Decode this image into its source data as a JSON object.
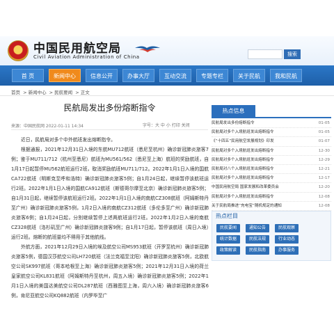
{
  "header": {
    "cn_title": "中国民用航空局",
    "en_title": "Civil Aviation Administration of China",
    "search_placeholder": "",
    "search_button": "搜索"
  },
  "nav": {
    "items": [
      {
        "label": "首 页",
        "active": false
      },
      {
        "label": "新闻中心",
        "active": true
      },
      {
        "label": "信息公开",
        "active": false
      },
      {
        "label": "办事大厅",
        "active": false
      },
      {
        "label": "互动交流",
        "active": false
      },
      {
        "label": "专题专栏",
        "active": false
      },
      {
        "label": "关于民航",
        "active": false
      },
      {
        "label": "我和民航",
        "active": false
      }
    ]
  },
  "breadcrumb": [
    "首页",
    "> 新闻中心",
    "> 民航要闻",
    "> 正文"
  ],
  "article": {
    "title": "民航局发出多份熔断指令",
    "meta_left": "来源：中国民航网     2022-01-11 14:34",
    "meta_right": "字号：大 中 小    打印    关闭",
    "paragraphs": [
      "近日，民航局对多个中外航班发出熔断指令。",
      "根据通报，2021年12月31日入境的东航MU712航班（悉尼至杭州）确诊新冠肺炎旅客7例；鉴于MU711/712（杭州至悉尼）航班为MU561/562（悉尼至上海）航班的奖励航班，自1月17日起暂停MU562航班运行2班，取消奖励航班MU711/712。2022年1月1日入境的国航CA722航班（明斯克至呼和浩特）确诊新冠肺炎旅客5例；自1月24日起，继续暂停该航班运行2班。2022年1月1日入境的国航CA912航班（斯德哥尔摩至北京）确诊新冠肺炎旅客5例；自1月31日起，继续暂停该航班运行2班。2022年1月1日入境的南航CZ308航班（阿姆斯特丹至广州）确诊新冠肺炎旅客5例，1月2日入境的南航CZ312航班（多伦多至广州）确诊新冠肺炎旅客6例；自1月24日起，分别继续暂停上述两航班运行2班。2022年1月2日入境的南航CZ328航班（洛杉矶至广州）确诊新冠肺炎旅客9例；自1月17日起，暂停该航班（周日入境）运行2班。熔断的航班量均不得用于其他航线。",
      "外航方面，2021年12月29日入境的埃及航空公司MS953航班（开罗至杭州）确诊新冠肺炎旅客5例，德国汉莎航空公司LH720航班（法兰克福至沈阳）确诊新冠肺炎旅客5例，北欧航空公司SK997航班（哥本哈根至上海）确诊新冠肺炎旅客5例；2021年12月31日入境的荷兰皇家航空公司KL831航班（阿姆斯特丹至杭州，周五入境）确诊新冠肺炎旅客5例；2022年1月1日入境的美国达美航空公司DL287航班（西雅图至上海，周六入境）确诊新冠肺炎旅客6例，肯尼亚航空公司KQ882航班（内罗毕至广"
    ]
  },
  "sidebar": {
    "news_tab": "热点信息",
    "news": [
      {
        "title": "民航局发出多份熔断指令",
        "date": "01-05"
      },
      {
        "title": "民航局对多个入境航班发出熔断指令",
        "date": "01-05"
      },
      {
        "title": "《“十四五”民用航空发展规划》印发",
        "date": "01-07"
      },
      {
        "title": "民航局对多个入境航班发出熔断指令",
        "date": "12-30"
      },
      {
        "title": "民航局对多个入境航班发出熔断指令",
        "date": "12-29"
      },
      {
        "title": "民航局对八个入境航班发出熔断指令",
        "date": "12-21"
      },
      {
        "title": "民航局对多个入境航班发出熔断指令",
        "date": "12-17"
      },
      {
        "title": "中国民用航空局 国家发展和改革委员会",
        "date": "12-20"
      },
      {
        "title": "民航局对多个入境航班发出熔断指令",
        "date": "12-08"
      },
      {
        "title": "关于民航局推进“充电宝”随机规定的通知",
        "date": "12-08"
      }
    ],
    "hot_title": "热点栏目",
    "hot_links": [
      "民航要闻",
      "通知公告",
      "民航观察",
      "统计数据",
      "民航法规",
      "行业动态",
      "政策解读",
      "民航指南",
      "办事服务"
    ]
  }
}
